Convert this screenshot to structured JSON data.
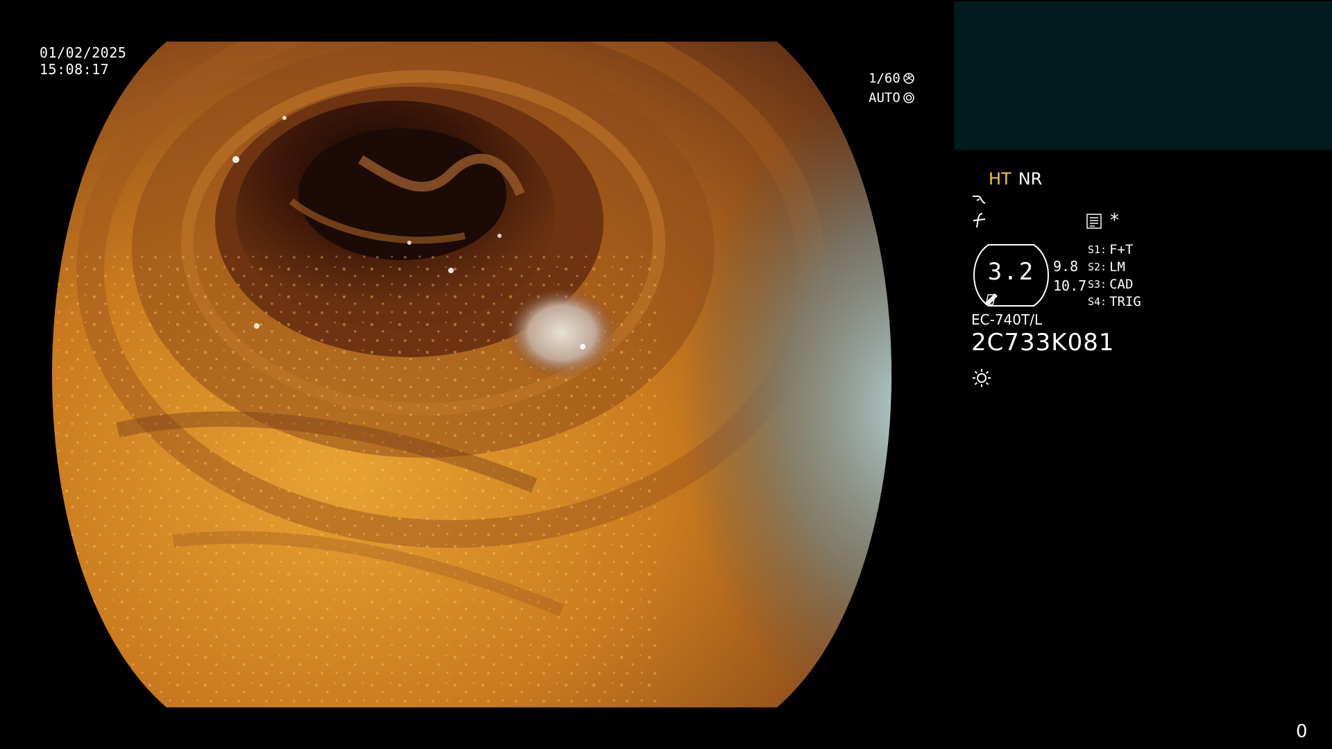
{
  "overlay": {
    "date": "01/02/2025",
    "time": "15:08:17",
    "shutter": "1/60",
    "exposure_mode": "AUTO",
    "shutter_icon": "aperture-icon",
    "auto_icon": "iris-icon"
  },
  "status": {
    "ht": "HT",
    "nr": "NR",
    "ht_color": "#f4c542"
  },
  "indicators": {
    "mode_icon_1": "curve-icon",
    "mode_icon_2": "slash-f-icon",
    "menu_icon": "list-icon",
    "asterisk": "*",
    "light_icon": "sun-icon"
  },
  "gauge": {
    "value": "3.2",
    "upper": "9.8",
    "lower": "10.7"
  },
  "scene_buttons": [
    {
      "key": "S1:",
      "label": "F+T"
    },
    {
      "key": "S2:",
      "label": "LM"
    },
    {
      "key": "S3:",
      "label": "CAD"
    },
    {
      "key": "S4:",
      "label": "TRIG"
    }
  ],
  "scope": {
    "model": "EC-740T/L",
    "serial": "2C733K081"
  },
  "footer": {
    "counter": "0"
  },
  "colors": {
    "thumbnail_bg": "#011a1c",
    "mucosa_primary": "#c5751e",
    "mucosa_dark": "#5a2a10",
    "lumen": "#1a0805",
    "lateral_highlight": "#9fc5cf"
  }
}
